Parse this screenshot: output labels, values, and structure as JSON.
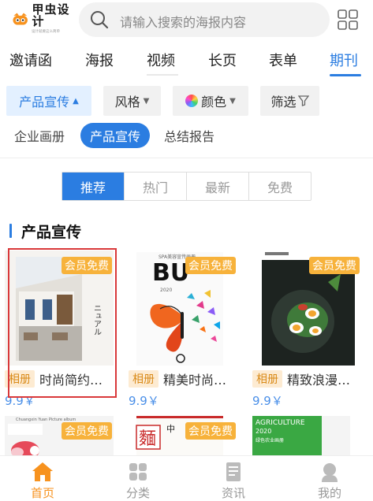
{
  "header": {
    "logo_name": "甲虫设计",
    "logo_slogan": "设计就要这么简单",
    "search_placeholder": "请输入搜索的海报内容"
  },
  "category_tabs": [
    {
      "label": "邀请函",
      "active": false
    },
    {
      "label": "海报",
      "active": false
    },
    {
      "label": "视频",
      "active": false
    },
    {
      "label": "长页",
      "active": false
    },
    {
      "label": "表单",
      "active": false
    },
    {
      "label": "期刊",
      "active": true
    }
  ],
  "filters": {
    "product": "产品宣传",
    "style": "风格",
    "color": "颜色",
    "screen": "筛选"
  },
  "subtags": [
    {
      "label": "企业画册",
      "active": false
    },
    {
      "label": "产品宣传",
      "active": true
    },
    {
      "label": "总结报告",
      "active": false
    }
  ],
  "segment": [
    {
      "label": "推荐",
      "active": true
    },
    {
      "label": "热门",
      "active": false
    },
    {
      "label": "最新",
      "active": false
    },
    {
      "label": "免费",
      "active": false
    }
  ],
  "section_title": "产品宣传",
  "cards": [
    {
      "badge": "会员免费",
      "tag": "相册",
      "title": "时尚简约…",
      "price": "9.9￥",
      "selected": true,
      "cover_text": "ニュアル"
    },
    {
      "badge": "会员免费",
      "tag": "相册",
      "title": "精美时尚…",
      "price": "9.9￥",
      "selected": false,
      "cover_text": "BU",
      "cover_sub": "SPA美容宣传画册",
      "cover_year": "2020"
    },
    {
      "badge": "会员免费",
      "tag": "相册",
      "title": "精致浪漫…",
      "price": "9.9￥",
      "selected": false
    }
  ],
  "cards_row2": [
    {
      "badge": "会员免费",
      "cover_text": "Chuangxin Yuan Picture album"
    },
    {
      "badge": "会员免费",
      "cover_text": "麵",
      "cover_sub": "中"
    },
    {
      "cover_text": "AGRICULTURE",
      "cover_year": "2020",
      "cover_sub": "绿色农业画册"
    }
  ],
  "bottom_nav": [
    {
      "label": "首页",
      "icon": "home-icon",
      "active": true
    },
    {
      "label": "分类",
      "icon": "category-icon",
      "active": false
    },
    {
      "label": "资讯",
      "icon": "news-icon",
      "active": false
    },
    {
      "label": "我的",
      "icon": "profile-icon",
      "active": false
    }
  ],
  "colors": {
    "accent": "#2b7de1",
    "badge": "#f7b23b",
    "nav_active": "#f7921e",
    "price": "#4a8fe8"
  }
}
